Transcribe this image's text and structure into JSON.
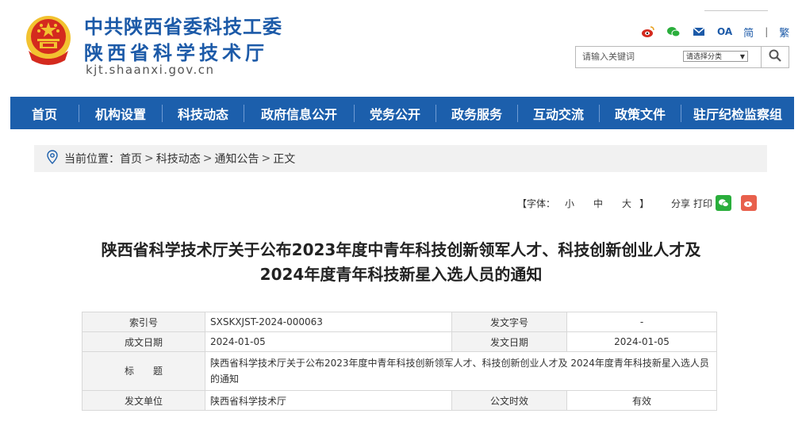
{
  "header": {
    "org_line1": "中共陕西省委科技工委",
    "org_line2": "陕西省科学技术厅",
    "domain": "kjt.shaanxi.gov.cn",
    "oa_label": "OA",
    "lang_simplified": "简",
    "lang_traditional": "繁",
    "lang_separator": "|",
    "search": {
      "placeholder": "请输入关键词",
      "category_label": "请选择分类",
      "search_icon": "magnifier-icon"
    },
    "icons": [
      "weibo-icon",
      "wechat-icon",
      "mail-icon"
    ]
  },
  "nav": {
    "items": [
      "首页",
      "机构设置",
      "科技动态",
      "政府信息公开",
      "党务公开",
      "政务服务",
      "互动交流",
      "政策文件",
      "驻厅纪检监察组"
    ]
  },
  "breadcrumb": {
    "prefix": "当前位置：",
    "items": [
      "首页",
      "科技动态",
      "通知公告",
      "正文"
    ],
    "separator": ">"
  },
  "tools": {
    "font_open": "【字体：",
    "font_small": "小",
    "font_medium": "中",
    "font_large": "大",
    "font_close": "】",
    "share_label": "分享",
    "print_label": "打印"
  },
  "article": {
    "title_line1": "陕西省科学技术厅关于公布2023年度中青年科技创新领军人才、科技创新创业人才及",
    "title_line2": "2024年度青年科技新星入选人员的通知"
  },
  "info": {
    "index_label": "索引号",
    "index_value": "SXSKXJST-2024-000063",
    "docno_label": "发文字号",
    "docno_value": "-",
    "created_label": "成文日期",
    "created_value": "2024-01-05",
    "issued_label": "发文日期",
    "issued_value": "2024-01-05",
    "title_label": "标　　题",
    "title_value": "陕西省科学技术厅关于公布2023年度中青年科技创新领军人才、科技创新创业人才及 2024年度青年科技新星入选人员的通知",
    "issuer_label": "发文单位",
    "issuer_value": "陕西省科学技术厅",
    "validity_label": "公文时效",
    "validity_value": "有效"
  },
  "colors": {
    "brand_blue": "#1c5fac",
    "emblem_red": "#d42a1e",
    "emblem_gold": "#f2c230"
  }
}
